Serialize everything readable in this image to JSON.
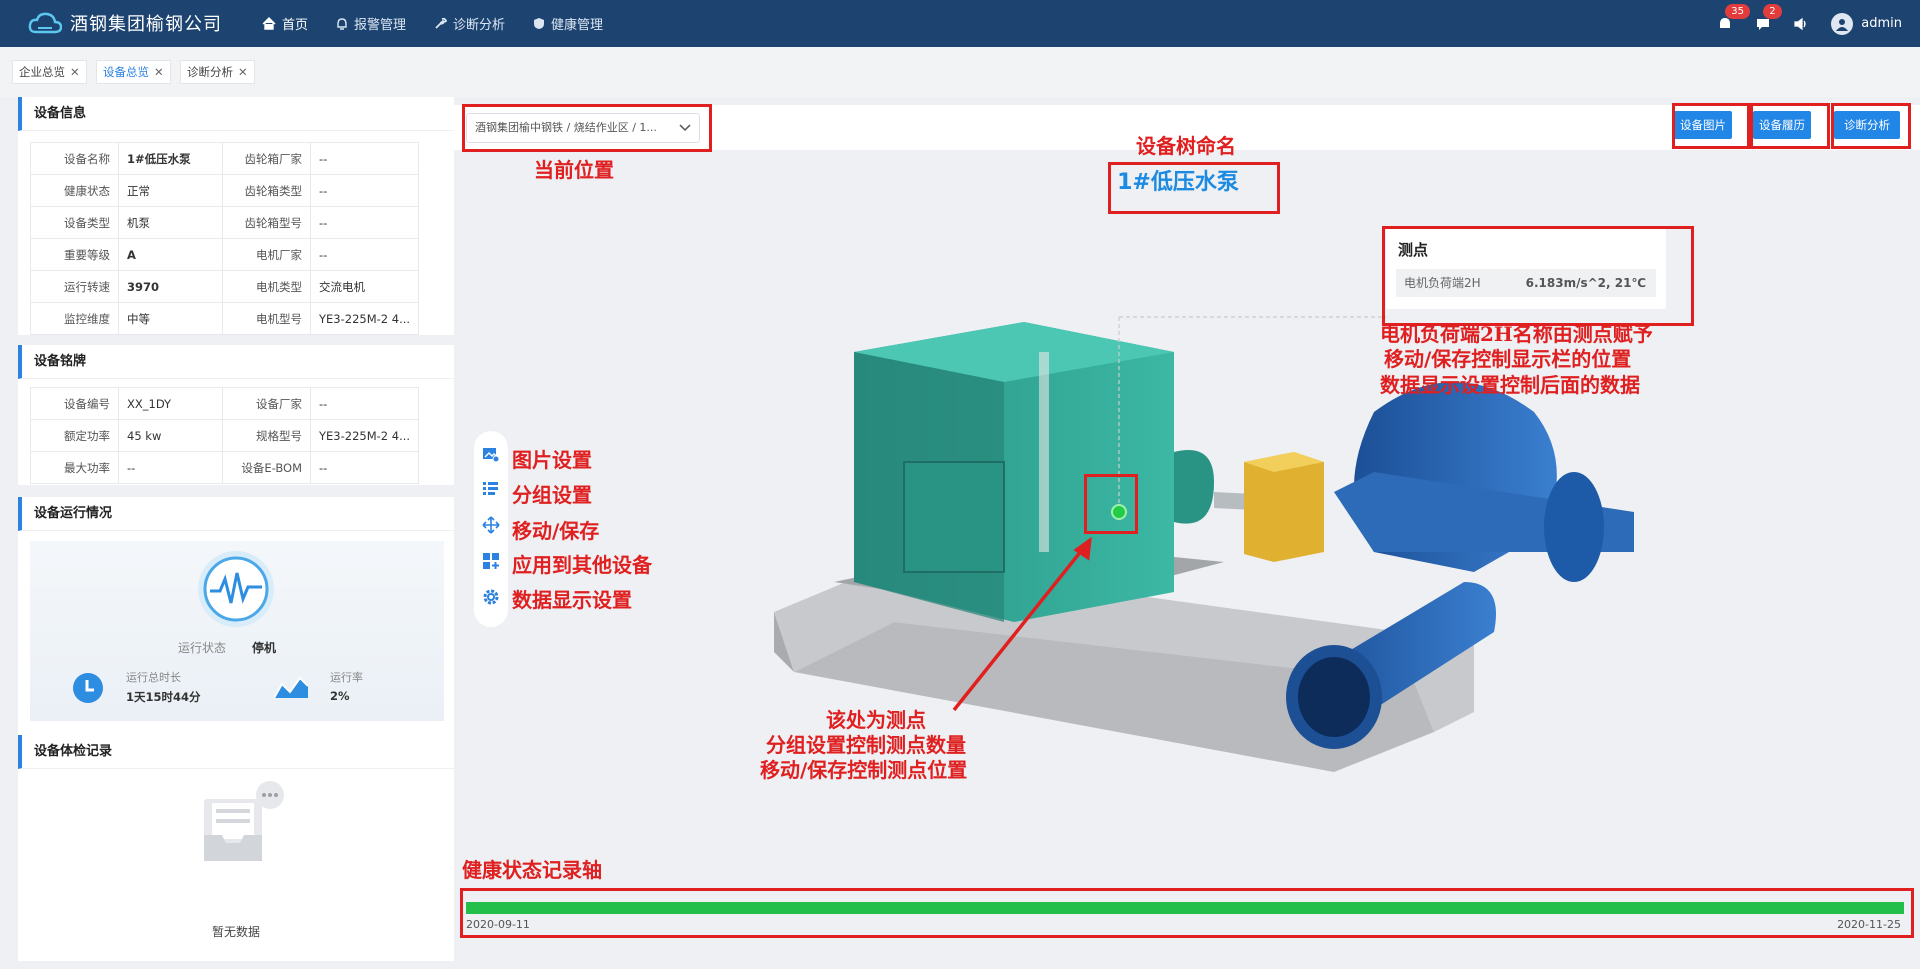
{
  "header": {
    "logo_text": "酒钢集团榆钢公司",
    "nav": [
      {
        "label": "首页",
        "icon": "home-icon"
      },
      {
        "label": "报警管理",
        "icon": "alarm-icon"
      },
      {
        "label": "诊断分析",
        "icon": "wrench-icon"
      },
      {
        "label": "健康管理",
        "icon": "shield-icon"
      }
    ],
    "alarm_badge": "35",
    "message_badge": "2",
    "username": "admin"
  },
  "tabs": [
    {
      "label": "企业总览"
    },
    {
      "label": "设备总览"
    },
    {
      "label": "诊断分析"
    }
  ],
  "device_info": {
    "title": "设备信息",
    "rows": [
      {
        "k1": "设备名称",
        "v1": "1#低压水泵",
        "k2": "齿轮箱厂家",
        "v2": "--"
      },
      {
        "k1": "健康状态",
        "v1": "正常",
        "k2": "齿轮箱类型",
        "v2": "--"
      },
      {
        "k1": "设备类型",
        "v1": "机泵",
        "k2": "齿轮箱型号",
        "v2": "--"
      },
      {
        "k1": "重要等级",
        "v1": "A",
        "k2": "电机厂家",
        "v2": "--"
      },
      {
        "k1": "运行转速",
        "v1": "3970",
        "k2": "电机类型",
        "v2": "交流电机"
      },
      {
        "k1": "监控维度",
        "v1": "中等",
        "k2": "电机型号",
        "v2": "YE3-225M-2 4..."
      }
    ]
  },
  "nameplate": {
    "title": "设备铭牌",
    "rows": [
      {
        "k1": "设备编号",
        "v1": "XX_1DY",
        "k2": "设备厂家",
        "v2": "--"
      },
      {
        "k1": "额定功率",
        "v1": "45 kw",
        "k2": "规格型号",
        "v2": "YE3-225M-2 4..."
      },
      {
        "k1": "最大功率",
        "v1": "--",
        "k2": "设备E-BOM",
        "v2": "--"
      }
    ]
  },
  "operation": {
    "title": "设备运行情况",
    "status_label": "运行状态",
    "status_value": "停机",
    "runtime_label": "运行总时长",
    "runtime_value": "1天15时44分",
    "rate_label": "运行率",
    "rate_value": "2%"
  },
  "inspection": {
    "title": "设备体检记录",
    "empty_text": "暂无数据"
  },
  "main": {
    "location": "酒钢集团榆中钢铁 / 烧结作业区 / 1...",
    "buttons": [
      "设备图片",
      "设备履历",
      "诊断分析"
    ],
    "device_name": "1#低压水泵",
    "measure_point": {
      "title": "测点",
      "name": "电机负荷端2H",
      "value": "6.183m/s^2, 21℃"
    },
    "tools": [
      {
        "icon": "image-settings-icon",
        "label": "图片设置"
      },
      {
        "icon": "group-settings-icon",
        "label": "分组设置"
      },
      {
        "icon": "move-save-icon",
        "label": "移动/保存"
      },
      {
        "icon": "apply-other-device-icon",
        "label": "应用到其他设备"
      },
      {
        "icon": "gear-icon",
        "label": "数据显示设置"
      }
    ],
    "timeline_start": "2020-09-11",
    "timeline_end": "2020-11-25"
  },
  "annotations": {
    "current_location": "当前位置",
    "tree_name": "设备树命名",
    "mp_note_1": "电机负荷端2H名称由测点赋予",
    "mp_note_2": "移动/保存控制显示栏的位置",
    "mp_note_3": "数据显示设置控制后面的数据",
    "point_note_1": "该处为测点",
    "point_note_2": "分组设置控制测点数量",
    "point_note_3": "移动/保存控制测点位置",
    "timeline_note": "健康状态记录轴"
  },
  "colors": {
    "header_bg": "#1d4470",
    "accent": "#2b82e0",
    "button": "#2286e6",
    "annotation": "#e02020",
    "timeline": "#22c04a",
    "motor": "#2fa392",
    "pump": "#2d6bb8",
    "coupling_guard": "#e0b030"
  }
}
